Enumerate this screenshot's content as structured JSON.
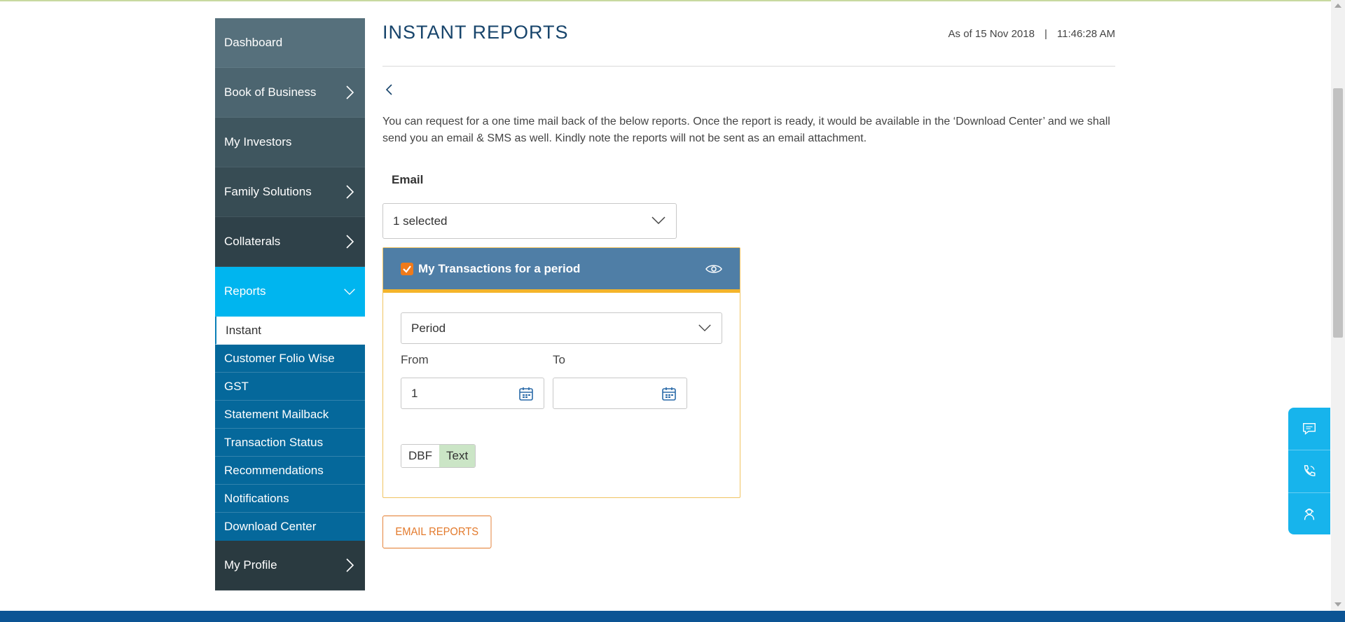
{
  "sidebar": {
    "items": [
      {
        "label": "Dashboard",
        "bg": "#56707c"
      },
      {
        "label": "Book of Business",
        "bg": "#4c6570"
      },
      {
        "label": "My Investors",
        "bg": "#3f565f"
      },
      {
        "label": "Family Solutions",
        "bg": "#374c54"
      },
      {
        "label": "Collaterals",
        "bg": "#2f4149"
      },
      {
        "label": "Reports",
        "bg": "#00b5ef"
      }
    ],
    "sub_items": [
      {
        "label": "Instant"
      },
      {
        "label": "Customer Folio Wise"
      },
      {
        "label": "GST"
      },
      {
        "label": "Statement Mailback"
      },
      {
        "label": "Transaction Status"
      },
      {
        "label": "Recommendations"
      },
      {
        "label": "Notifications"
      },
      {
        "label": "Download Center"
      }
    ],
    "bottom_item": {
      "label": "My Profile",
      "bg": "#2a3a40"
    }
  },
  "header": {
    "title": "INSTANT REPORTS",
    "as_of": "As of 15 Nov 2018",
    "separator": "|",
    "time": "11:46:28 AM"
  },
  "description": "You can request for a one time mail back of the below reports. Once the report is ready, it would be available in the ‘Download Center’ and we shall send you an email & SMS as well. Kindly note the reports will not be sent as an email attachment.",
  "email": {
    "label": "Email",
    "selected_value": "1 selected"
  },
  "report_card": {
    "title": "My Transactions for a period",
    "checked": true,
    "period_select": "Period",
    "from_label": "From",
    "to_label": "To",
    "from_value": "1",
    "to_value": "",
    "format_options": [
      "DBF",
      "Text"
    ],
    "selected_format": "Text"
  },
  "actions": {
    "email_reports": "EMAIL REPORTS"
  },
  "floating": {
    "icons": [
      "chat-icon",
      "phone-icon",
      "support-icon"
    ]
  },
  "colors": {
    "accent": "#00b5ef",
    "title": "#17446b",
    "button": "#e37a2c",
    "card_header": "#4f7ea6",
    "card_border": "#f4b42a"
  }
}
